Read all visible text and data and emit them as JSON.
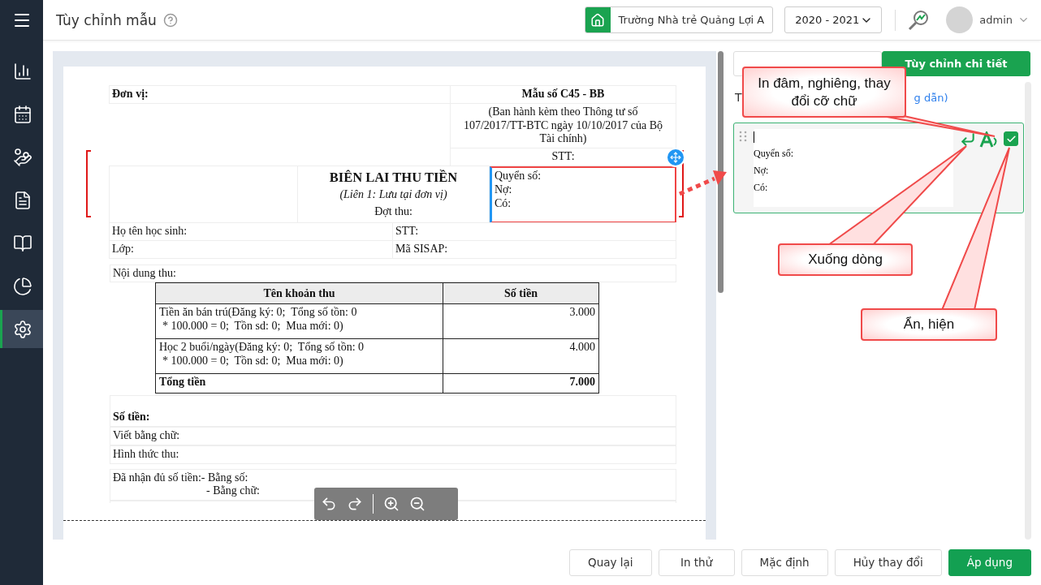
{
  "header": {
    "title": "Tùy chỉnh mẫu",
    "school": "Trường Nhà trẻ Quảng Lợi A",
    "year": "2020 - 2021",
    "user": "admin"
  },
  "sidebar": {
    "items": [
      {
        "kind": "chart",
        "selected": false
      },
      {
        "kind": "calendar",
        "selected": false
      },
      {
        "kind": "coins",
        "selected": false
      },
      {
        "kind": "document",
        "selected": false
      },
      {
        "kind": "book",
        "selected": false
      },
      {
        "kind": "pie",
        "selected": false
      },
      {
        "kind": "settings",
        "selected": true
      }
    ]
  },
  "document": {
    "unit": "Đơn vị:",
    "form_no": "Mẫu số C45 - BB",
    "issued": "(Ban hành kèm theo Thông tư số 107/2017/TT-BTC ngày 10/10/2017 của Bộ Tài chính)",
    "stt_top": "STT:",
    "title": "BIÊN LAI THU TIỀN",
    "subtitle": "(Liên 1: Lưu tại đơn vị)",
    "period": "Đợt thu:",
    "book_lines": [
      "Quyển số:",
      "Nợ:",
      "Có:"
    ],
    "field_rows": [
      [
        "Họ tên học sinh:",
        "STT:"
      ],
      [
        "Lớp:",
        "Mã SISAP:"
      ]
    ],
    "content_label": "Nội dung thu:",
    "fee_table": {
      "columns": [
        "Tên khoản thu",
        "Số tiền"
      ],
      "rows": [
        {
          "lines": [
            "Tiền ăn bán trú(Đăng ký: 0;  Tổng số tồn: 0",
            "* 100.000 = 0;  Tồn sd: 0;  Mua mới: 0)"
          ],
          "amount": "3.000"
        },
        {
          "lines": [
            "Học 2 buổi/ngày(Đăng ký: 0;  Tổng số tồn: 0",
            "* 100.000 = 0;  Tồn sd: 0;  Mua mới: 0)"
          ],
          "amount": "4.000"
        }
      ],
      "total": {
        "label": "Tổng tiền",
        "amount": "7.000"
      }
    },
    "amount_label": "Số tiền:",
    "in_words": "Viết bằng chữ:",
    "method": "Hình thức thu:",
    "received": [
      "Đã nhận đủ số tiền:- Bằng số:",
      "- Bằng chữ:"
    ]
  },
  "toolbar": [
    {
      "kind": "undo"
    },
    {
      "kind": "redo"
    },
    {
      "kind": "zoom-in"
    },
    {
      "kind": "zoom-out"
    }
  ],
  "panel": {
    "tabs": [
      {
        "selected": false
      },
      {
        "label": "Tùy chỉnh chi tiết",
        "selected": true
      }
    ],
    "heading": "T",
    "link": "g dẫn)",
    "block": {
      "lines": [
        "Quyển số:",
        "Nợ:",
        "Có:"
      ],
      "visible": true
    }
  },
  "callouts": [
    {
      "text": "In đâm, nghiêng, thay đổi cỡ chữ"
    },
    {
      "text": "Xuống dòng"
    },
    {
      "text": "Ẩn, hiện"
    }
  ],
  "footer": {
    "buttons": [
      {
        "label": "Quay lại",
        "kind": "default"
      },
      {
        "label": "In thử",
        "kind": "default"
      },
      {
        "label": "Mặc định",
        "kind": "default"
      },
      {
        "label": "Hủy thay đổi",
        "kind": "default"
      },
      {
        "label": "Áp dụng",
        "kind": "primary"
      }
    ]
  }
}
